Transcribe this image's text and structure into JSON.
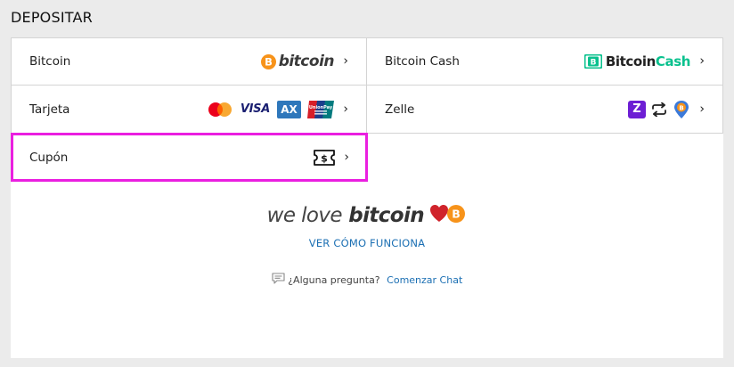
{
  "page": {
    "title": "DEPOSITAR"
  },
  "options": {
    "bitcoin": {
      "label": "Bitcoin",
      "logo_text": "bitcoin",
      "logo_symbol": "฿"
    },
    "bitcoin_cash": {
      "label": "Bitcoin Cash",
      "logo_text_a": "Bitcoin",
      "logo_text_b": "Cash"
    },
    "tarjeta": {
      "label": "Tarjeta",
      "visa": "VISA",
      "amex": "AX",
      "unionpay": "UnionPay"
    },
    "zelle": {
      "label": "Zelle",
      "zelle_glyph": "Z"
    },
    "cupon": {
      "label": "Cupón",
      "coupon_glyph": "$"
    },
    "chevron": "›"
  },
  "promo": {
    "tagline_a": "we love",
    "tagline_b": "bitcoin",
    "link": "VER CÓMO FUNCIONA"
  },
  "help": {
    "question": "¿Alguna pregunta?",
    "chat_link": "Comenzar Chat"
  },
  "colors": {
    "bitcoin_orange": "#f7931a",
    "bch_green": "#0ac18e",
    "selected_border": "#ea1fe0",
    "link_blue": "#1b6fb3",
    "zelle_purple": "#6d1ed4",
    "heart_red": "#d0232b"
  },
  "icons": [
    "bitcoin-icon",
    "bitcoin-cash-icon",
    "mastercard-icon",
    "visa-icon",
    "amex-icon",
    "unionpay-icon",
    "zelle-icon",
    "exchange-arrows-icon",
    "location-pin-icon",
    "coupon-ticket-icon",
    "heart-icon",
    "chat-bubble-icon",
    "chevron-right-icon"
  ]
}
